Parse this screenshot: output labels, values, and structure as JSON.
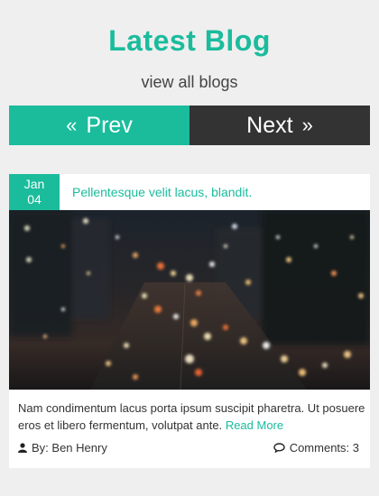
{
  "header": {
    "title": "Latest Blog",
    "subtitle": "view all blogs"
  },
  "nav": {
    "prev_label": "Prev",
    "next_label": "Next",
    "prev_icon": "double-chevron-left-icon",
    "next_icon": "double-chevron-right-icon"
  },
  "post": {
    "date_month": "Jan",
    "date_day": "04",
    "title": "Pellentesque velit lacus, blandit.",
    "image": "city-traffic-bokeh-photo",
    "excerpt": "Nam condimentum lacus porta ipsum suscipit pharetra. Ut posuere eros et libero fermentum, volutpat ante.",
    "read_more": "Read More",
    "author": "By: Ben Henry",
    "comments": "Comments: 3",
    "author_icon": "user-icon",
    "comments_icon": "comments-icon"
  },
  "colors": {
    "accent": "#1abc9c",
    "dark": "#333333",
    "background": "#efefef"
  }
}
